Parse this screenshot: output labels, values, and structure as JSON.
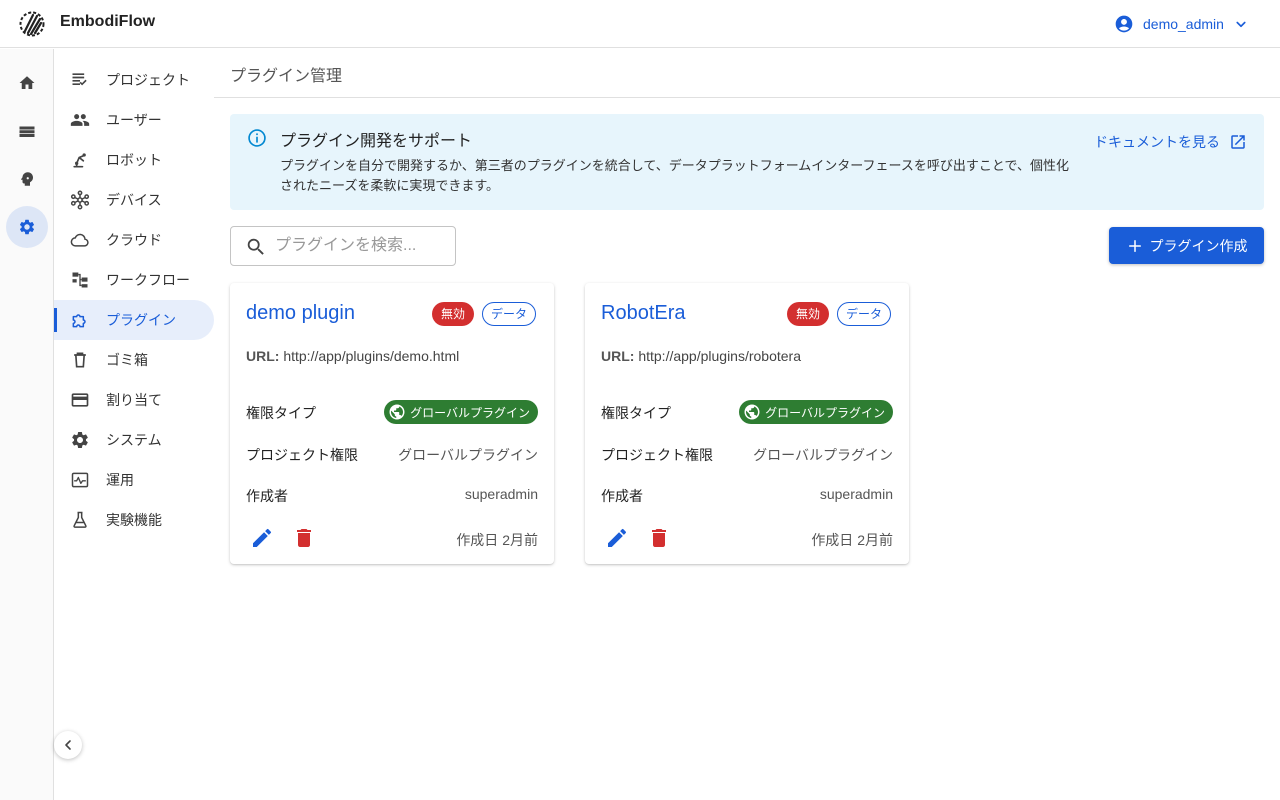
{
  "app": {
    "name": "EmbodiFlow"
  },
  "user": {
    "name": "demo_admin"
  },
  "sidebar": {
    "items": [
      {
        "label": "プロジェクト",
        "icon": "project-list-icon"
      },
      {
        "label": "ユーザー",
        "icon": "users-icon"
      },
      {
        "label": "ロボット",
        "icon": "robot-arm-icon"
      },
      {
        "label": "デバイス",
        "icon": "device-hub-icon"
      },
      {
        "label": "クラウド",
        "icon": "cloud-icon"
      },
      {
        "label": "ワークフロー",
        "icon": "workflow-icon"
      },
      {
        "label": "プラグイン",
        "icon": "puzzle-icon",
        "active": true
      },
      {
        "label": "ゴミ箱",
        "icon": "trash-icon"
      },
      {
        "label": "割り当て",
        "icon": "card-icon"
      },
      {
        "label": "システム",
        "icon": "gear-icon"
      },
      {
        "label": "運用",
        "icon": "monitor-icon"
      },
      {
        "label": "実験機能",
        "icon": "flask-icon"
      }
    ]
  },
  "page": {
    "title": "プラグイン管理"
  },
  "info": {
    "title": "プラグイン開発をサポート",
    "body": "プラグインを自分で開発するか、第三者のプラグインを統合して、データプラットフォームインターフェースを呼び出すことで、個性化されたニーズを柔軟に実現できます。",
    "link": "ドキュメントを見る"
  },
  "search": {
    "placeholder": "プラグインを検索..."
  },
  "create_button": "プラグイン作成",
  "labels": {
    "url": "URL:",
    "permission_type": "権限タイプ",
    "project_permission": "プロジェクト権限",
    "creator": "作成者"
  },
  "plugins": [
    {
      "name": "demo plugin",
      "status": "無効",
      "category": "データ",
      "url": "http://app/plugins/demo.html",
      "permission_type": "グローバルプラグイン",
      "project_permission": "グローバルプラグイン",
      "creator": "superadmin",
      "created": "作成日 2月前"
    },
    {
      "name": "RobotEra",
      "status": "無効",
      "category": "データ",
      "url": "http://app/plugins/robotera",
      "permission_type": "グローバルプラグイン",
      "project_permission": "グローバルプラグイン",
      "creator": "superadmin",
      "created": "作成日 2月前"
    }
  ],
  "colors": {
    "accent": "#1a5dd8",
    "danger": "#d32f2f",
    "success": "#2e7d32",
    "info_bg": "#e7f5fc"
  }
}
